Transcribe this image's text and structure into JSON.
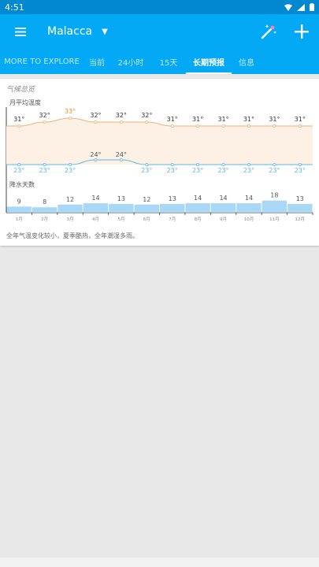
{
  "status": {
    "time": "4:51"
  },
  "appbar": {
    "location": "Malacca"
  },
  "tabs": [
    {
      "label": "MORE TO EXPLORE"
    },
    {
      "label": "当前"
    },
    {
      "label": "24小时"
    },
    {
      "label": "15天"
    },
    {
      "label": "长期预报"
    },
    {
      "label": "信息"
    }
  ],
  "card": {
    "section_title": "气候总览",
    "temp_title": "月平均温度",
    "rain_title": "降水天数",
    "summary": "全年气温变化较小，夏季酷热，全年潮湿多雨。"
  },
  "chart_data": {
    "type": "line",
    "categories": [
      "1月",
      "2月",
      "3月",
      "4月",
      "5月",
      "6月",
      "7月",
      "8月",
      "9月",
      "10月",
      "11月",
      "12月"
    ],
    "high_temps": [
      "31°",
      "32°",
      "33°",
      "32°",
      "32°",
      "32°",
      "31°",
      "31°",
      "31°",
      "31°",
      "31°",
      "31°"
    ],
    "high_values": [
      31,
      32,
      33,
      32,
      32,
      32,
      31,
      31,
      31,
      31,
      31,
      31
    ],
    "low_temps": [
      "23°",
      "23°",
      "23°",
      "24°",
      "24°",
      "23°",
      "23°",
      "23°",
      "23°",
      "23°",
      "23°",
      "23°"
    ],
    "low_values": [
      23,
      23,
      23,
      24,
      24,
      23,
      23,
      23,
      23,
      23,
      23,
      23
    ],
    "rain_days": [
      9,
      8,
      12,
      14,
      13,
      12,
      13,
      14,
      14,
      14,
      18,
      13
    ],
    "colors": {
      "high": "#f0b27a",
      "high_fill": "#fdf1e6",
      "low": "#5bb8e6",
      "rain": "#a8d8f5",
      "max_label": "#e8902d"
    }
  }
}
